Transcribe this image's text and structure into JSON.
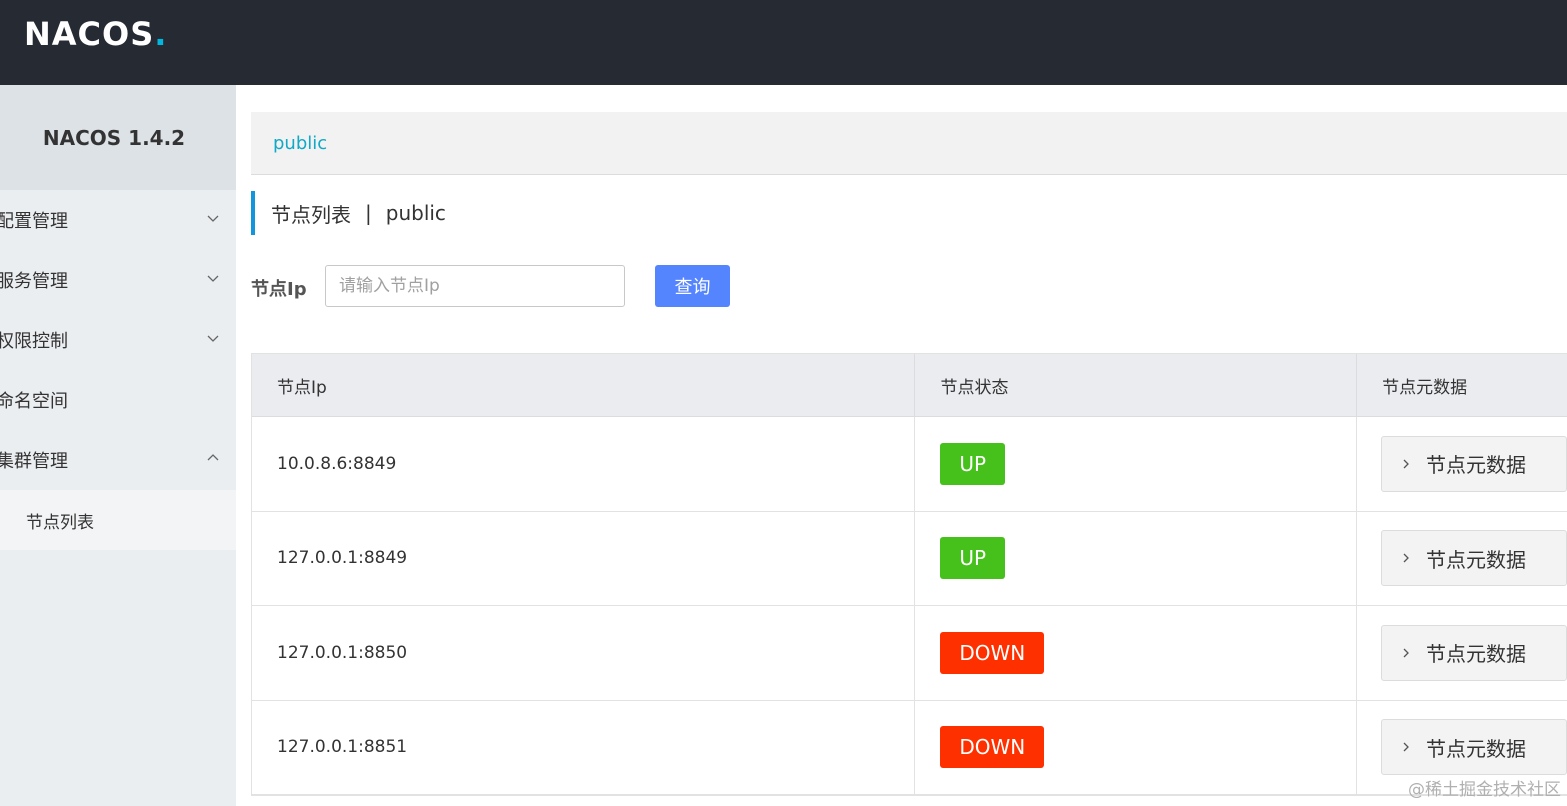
{
  "app": {
    "logo_text": "NACOS",
    "logo_dot": "."
  },
  "sidebar": {
    "version": "NACOS 1.4.2",
    "items": [
      {
        "label": "配置管理",
        "expanded": false
      },
      {
        "label": "服务管理",
        "expanded": false
      },
      {
        "label": "权限控制",
        "expanded": false
      },
      {
        "label": "命名空间"
      },
      {
        "label": "集群管理",
        "expanded": true
      }
    ],
    "submenu": [
      {
        "label": "节点列表"
      }
    ]
  },
  "namespace_bar": {
    "active": "public"
  },
  "page": {
    "title": "节点列表",
    "separator": "|",
    "namespace": "public"
  },
  "search": {
    "label": "节点Ip",
    "placeholder": "请输入节点Ip",
    "button": "查询"
  },
  "table": {
    "headers": [
      "节点Ip",
      "节点状态",
      "节点元数据"
    ],
    "rows": [
      {
        "ip": "10.0.8.6:8849",
        "status": "UP",
        "meta": "节点元数据"
      },
      {
        "ip": "127.0.0.1:8849",
        "status": "UP",
        "meta": "节点元数据"
      },
      {
        "ip": "127.0.0.1:8850",
        "status": "DOWN",
        "meta": "节点元数据"
      },
      {
        "ip": "127.0.0.1:8851",
        "status": "DOWN",
        "meta": "节点元数据"
      }
    ]
  },
  "colors": {
    "topbar": "#252a33",
    "accent": "#1296db",
    "up": "#46c01a",
    "down": "#ff3000",
    "primary_button": "#5584ff"
  },
  "watermark": "@稀土掘金技术社区"
}
